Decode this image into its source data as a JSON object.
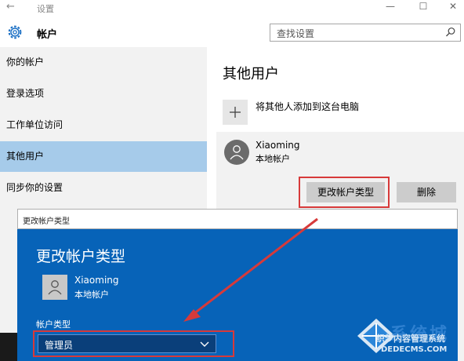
{
  "titlebar": {
    "back": "←",
    "title": "设置",
    "minimize": "—",
    "maximize": "☐",
    "close": "✕"
  },
  "header": {
    "app_name": "帐户",
    "search_placeholder": "查找设置"
  },
  "sidebar": {
    "items": [
      {
        "label": "你的帐户"
      },
      {
        "label": "登录选项"
      },
      {
        "label": "工作单位访问"
      },
      {
        "label": "其他用户"
      },
      {
        "label": "同步你的设置"
      }
    ]
  },
  "main": {
    "section_title": "其他用户",
    "add_label": "将其他人添加到这台电脑",
    "user": {
      "name": "Xiaoming",
      "type": "本地帐户"
    },
    "change_type_button": "更改帐户类型",
    "delete_button": "删除"
  },
  "dialog": {
    "window_title": "更改帐户类型",
    "heading": "更改帐户类型",
    "user": {
      "name": "Xiaoming",
      "type": "本地帐户"
    },
    "account_type_label": "帐户类型",
    "account_type_value": "管理员"
  },
  "watermark": {
    "brand": "系统城",
    "line1": "织梦内容管理系统",
    "line2": "DEDECMS.COM"
  },
  "colors": {
    "accent": "#0763b8",
    "selected_nav": "#a6cbea",
    "highlight": "#d73a3a"
  }
}
